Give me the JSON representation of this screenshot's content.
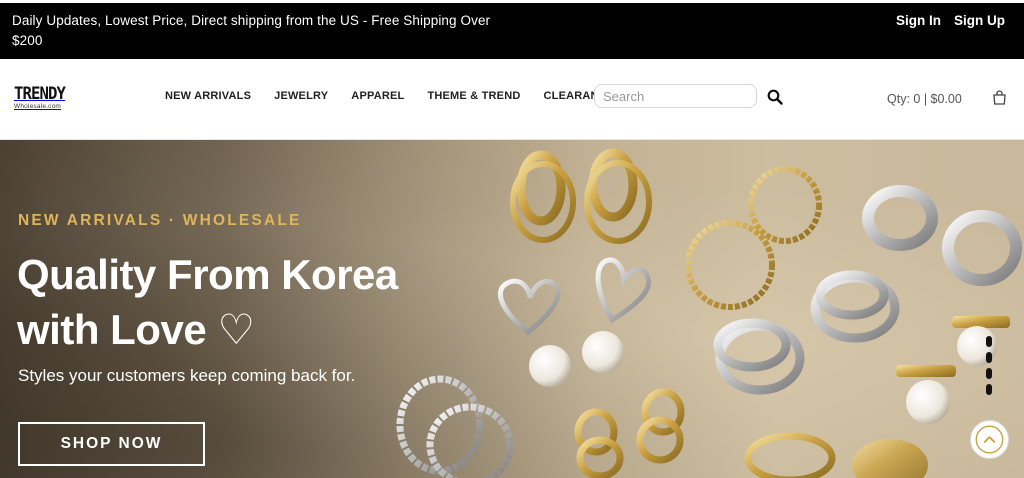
{
  "topbar": {
    "promo": "Daily Updates, Lowest Price, Direct shipping from the US - Free Shipping Over $200",
    "sign_in": "Sign In",
    "sign_up": "Sign Up"
  },
  "header": {
    "logo_main": "TRENDY",
    "logo_sub": "Wholesale.com",
    "nav": [
      "NEW ARRIVALS",
      "JEWELRY",
      "APPAREL",
      "THEME & TREND",
      "CLEARANCE"
    ],
    "search_placeholder": "Search",
    "search_value": "",
    "cart_summary": "Qty: 0 | $0.00",
    "icons": {
      "search": "search-icon",
      "cart": "shopping-bag-icon"
    }
  },
  "hero": {
    "eyebrow": "NEW ARRIVALS · WHOLESALE",
    "headline_line1": "Quality From Korea",
    "headline_line2": "with Love ♡",
    "subtitle": "Styles your customers keep coming back for.",
    "cta": "SHOP NOW",
    "accent_color": "#e0b45a",
    "icons": {
      "scroll_top": "chevron-up-icon"
    }
  }
}
